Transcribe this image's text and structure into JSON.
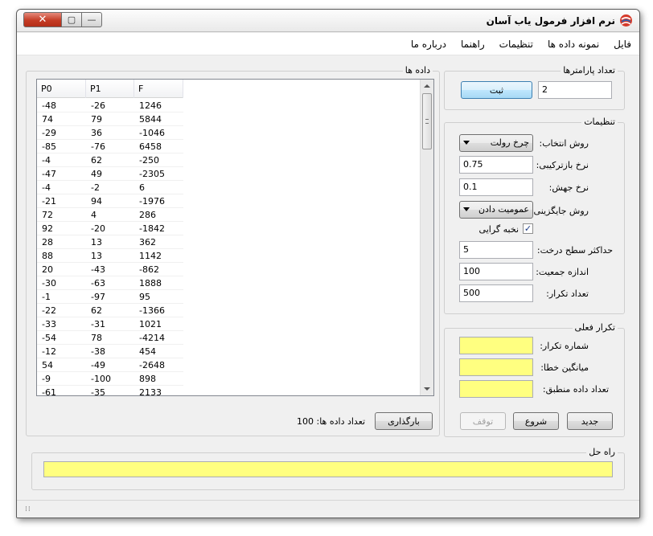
{
  "window": {
    "title": "نرم افزار فرمول یاب آسان",
    "close_glyph": "✕",
    "maximize_glyph": "▢",
    "minimize_glyph": "—"
  },
  "menu": [
    "فایل",
    "نمونه داده ها",
    "تنظیمات",
    "راهنما",
    "درباره ما"
  ],
  "data_panel": {
    "title": "داده ها",
    "columns": [
      "P0",
      "P1",
      "F"
    ],
    "rows": [
      [
        "-48",
        "-26",
        "1246"
      ],
      [
        "74",
        "79",
        "5844"
      ],
      [
        "-29",
        "36",
        "-1046"
      ],
      [
        "-85",
        "-76",
        "6458"
      ],
      [
        "-4",
        "62",
        "-250"
      ],
      [
        "-47",
        "49",
        "-2305"
      ],
      [
        "-4",
        "-2",
        "6"
      ],
      [
        "-21",
        "94",
        "-1976"
      ],
      [
        "72",
        "4",
        "286"
      ],
      [
        "92",
        "-20",
        "-1842"
      ],
      [
        "28",
        "13",
        "362"
      ],
      [
        "88",
        "13",
        "1142"
      ],
      [
        "20",
        "-43",
        "-862"
      ],
      [
        "-30",
        "-63",
        "1888"
      ],
      [
        "-1",
        "-97",
        "95"
      ],
      [
        "-22",
        "62",
        "-1366"
      ],
      [
        "-33",
        "-31",
        "1021"
      ],
      [
        "-54",
        "78",
        "-4214"
      ],
      [
        "-12",
        "-38",
        "454"
      ],
      [
        "54",
        "-49",
        "-2648"
      ],
      [
        "-9",
        "-100",
        "898"
      ],
      [
        "-61",
        "-35",
        "2133"
      ]
    ],
    "count_label": "تعداد داده ها: 100",
    "load_button": "بارگذاری"
  },
  "params_group": {
    "title": "تعداد پارامترها",
    "value": "2",
    "submit_button": "ثبت"
  },
  "settings_group": {
    "title": "تنظیمات",
    "selection_label": "روش انتخاب:",
    "selection_value": "چرخ رولت",
    "crossover_label": "نرخ بازترکیبی:",
    "crossover_value": "0.75",
    "mutation_label": "نرخ جهش:",
    "mutation_value": "0.1",
    "replacement_label": "روش جایگزینی:",
    "replacement_value": "عمومیت دادن",
    "elitism_label": "نخبه گرایی",
    "elitism_checked": true,
    "check_glyph": "✓",
    "max_depth_label": "حداکثر سطح درخت:",
    "max_depth_value": "5",
    "population_label": "اندازه جمعیت:",
    "population_value": "100",
    "iterations_label": "تعداد تکرار:",
    "iterations_value": "500"
  },
  "current_group": {
    "title": "تکرار فعلی",
    "iteration_number_label": "شماره تکرار:",
    "mean_error_label": "میانگین خطا:",
    "matched_count_label": "تعداد داده منطبق:"
  },
  "actions": {
    "new_button": "جدید",
    "start_button": "شروع",
    "stop_button": "توقف"
  },
  "solution_group": {
    "title": "راه حل"
  },
  "statusbar": {
    "grip": "⁞⁞"
  },
  "colors": {
    "output_bg": "#ffff80",
    "window_bg": "#f0f0f0",
    "close_red": "#c43c25"
  }
}
